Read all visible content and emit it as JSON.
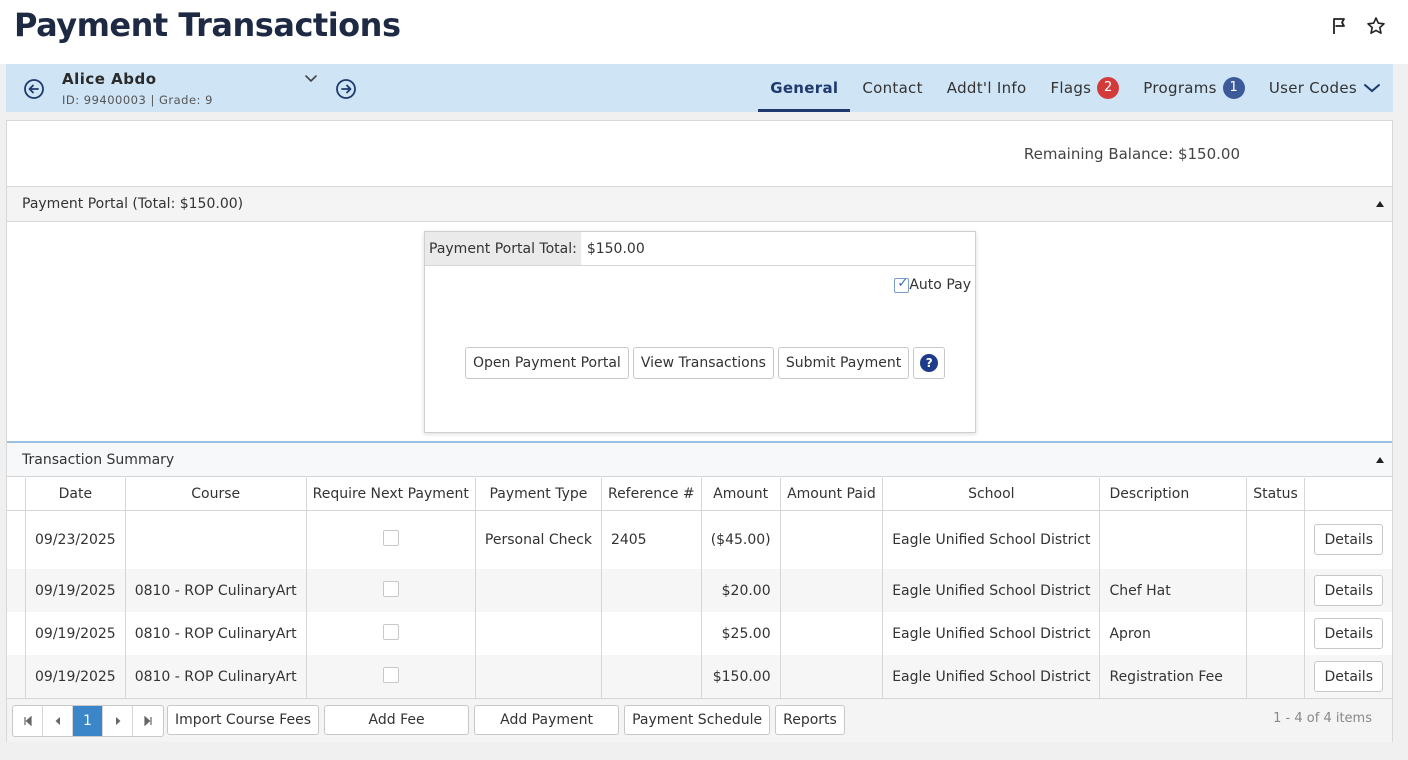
{
  "page": {
    "title": "Payment Transactions"
  },
  "header_icons": [
    "flag-icon",
    "star-icon"
  ],
  "student": {
    "name": "Alice Abdo",
    "meta": "ID: 99400003 |  Grade: 9"
  },
  "tabs": [
    {
      "label": "General",
      "active": true
    },
    {
      "label": "Contact"
    },
    {
      "label": "Addt'l Info"
    },
    {
      "label": "Flags",
      "badge": "2"
    },
    {
      "label": "Programs",
      "badge": "1"
    },
    {
      "label": "User Codes"
    }
  ],
  "balance": "Remaining Balance: $150.00",
  "portal_panel": {
    "header": "Payment Portal (Total: $150.00)",
    "total_label": "Payment Portal Total:",
    "total_value": "$150.00",
    "autopay_label": "Auto Pay",
    "autopay_checked": true,
    "buttons": {
      "open": "Open Payment Portal",
      "view": "View Transactions",
      "submit": "Submit Payment",
      "help": "?"
    }
  },
  "summary_panel": {
    "header": "Transaction Summary",
    "columns": [
      "",
      "Date",
      "Course",
      "Require Next Payment",
      "Payment Type",
      "Reference #",
      "Amount",
      "Amount Paid",
      "School",
      "Description",
      "Status",
      ""
    ],
    "rows": [
      {
        "date": "09/23/2025",
        "course": "",
        "payment_type": "Personal Check",
        "reference": "2405",
        "amount": "($45.00)",
        "amount_paid": "",
        "school": "Eagle Unified School District",
        "description": "",
        "status": "",
        "action": "Details"
      },
      {
        "date": "09/19/2025",
        "course": "0810 - ROP CulinaryArt",
        "payment_type": "",
        "reference": "",
        "amount": "$20.00",
        "amount_paid": "",
        "school": "Eagle Unified School District",
        "description": "Chef Hat",
        "status": "",
        "action": "Details"
      },
      {
        "date": "09/19/2025",
        "course": "0810 - ROP CulinaryArt",
        "payment_type": "",
        "reference": "",
        "amount": "$25.00",
        "amount_paid": "",
        "school": "Eagle Unified School District",
        "description": "Apron",
        "status": "",
        "action": "Details"
      },
      {
        "date": "09/19/2025",
        "course": "0810 - ROP CulinaryArt",
        "payment_type": "",
        "reference": "",
        "amount": "$150.00",
        "amount_paid": "",
        "school": "Eagle Unified School District",
        "description": "Registration Fee",
        "status": "",
        "action": "Details"
      }
    ]
  },
  "footer": {
    "pager": {
      "current": "1"
    },
    "buttons": {
      "import": "Import Course Fees",
      "add_fee": "Add Fee",
      "add_payment": "Add Payment",
      "schedule": "Payment Schedule",
      "reports": "Reports"
    },
    "count": "1 - 4 of 4 items"
  },
  "colors": {
    "accent": "#1e3a6e",
    "student_bar": "#cfe4f5",
    "flag_badge": "#d33b3b",
    "program_badge": "#3c5a99",
    "pager_active": "#3a86c8"
  }
}
